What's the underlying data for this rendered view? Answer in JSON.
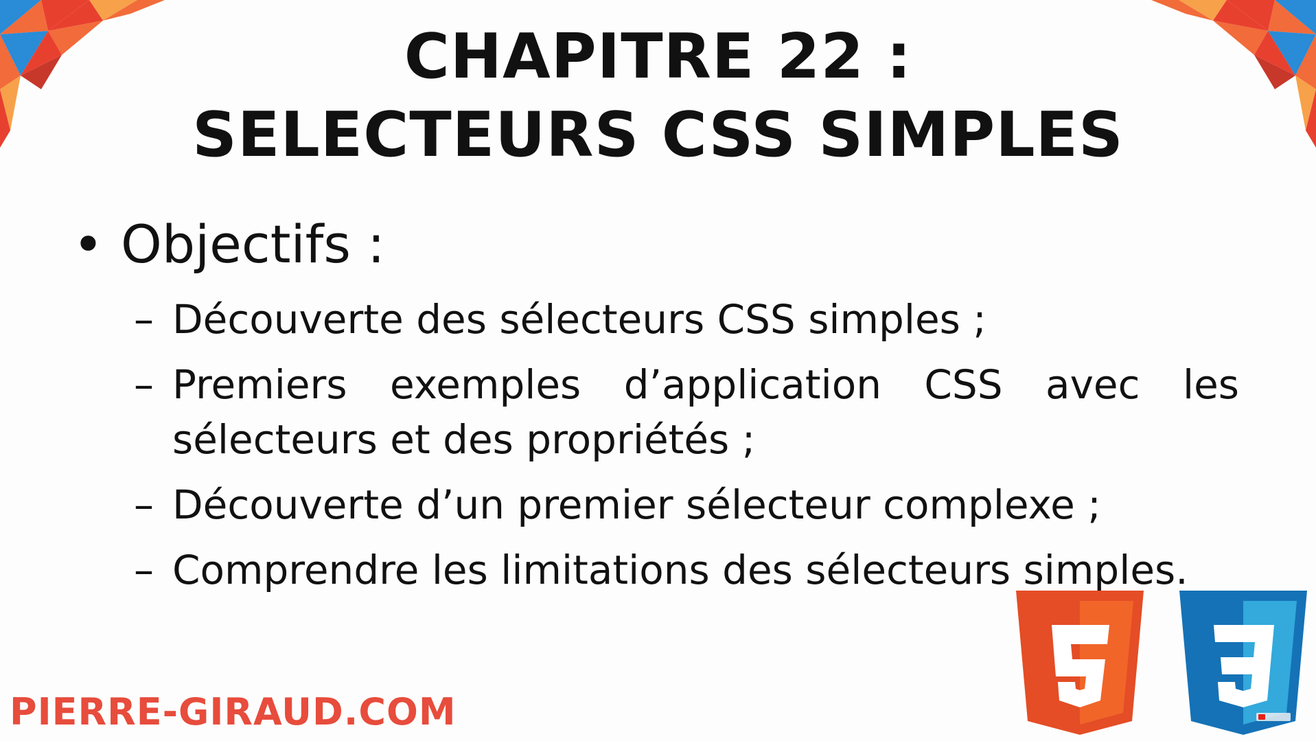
{
  "slide": {
    "title_line_1": "CHAPITRE 22 :",
    "title_line_2": "SELECTEURS CSS SIMPLES",
    "objectives_label": "Objectifs :",
    "bullet": "•",
    "dash": "–",
    "items": [
      "Découverte des sélecteurs CSS simples ;",
      "Premiers exemples d’application CSS avec les sélecteurs et des propriétés ;",
      "Découverte d’un premier sélecteur complexe ;",
      "Comprendre les limitations des sélecteurs simples."
    ],
    "site": "PIERRE-GIRAUD.COM"
  },
  "logos": {
    "html5_digit": "5",
    "css3_digit": "3",
    "html5_icon": "html5-logo-icon",
    "css3_icon": "css3-logo-icon"
  },
  "colors": {
    "text": "#111111",
    "site": "#e74c3c",
    "html5_dark": "#e44d26",
    "html5_light": "#f16529",
    "css3_dark": "#1572b6",
    "css3_light": "#33a9dc",
    "corner_orange": "#f26b3a",
    "corner_blue": "#2a8bd6",
    "corner_red": "#e8402f"
  }
}
